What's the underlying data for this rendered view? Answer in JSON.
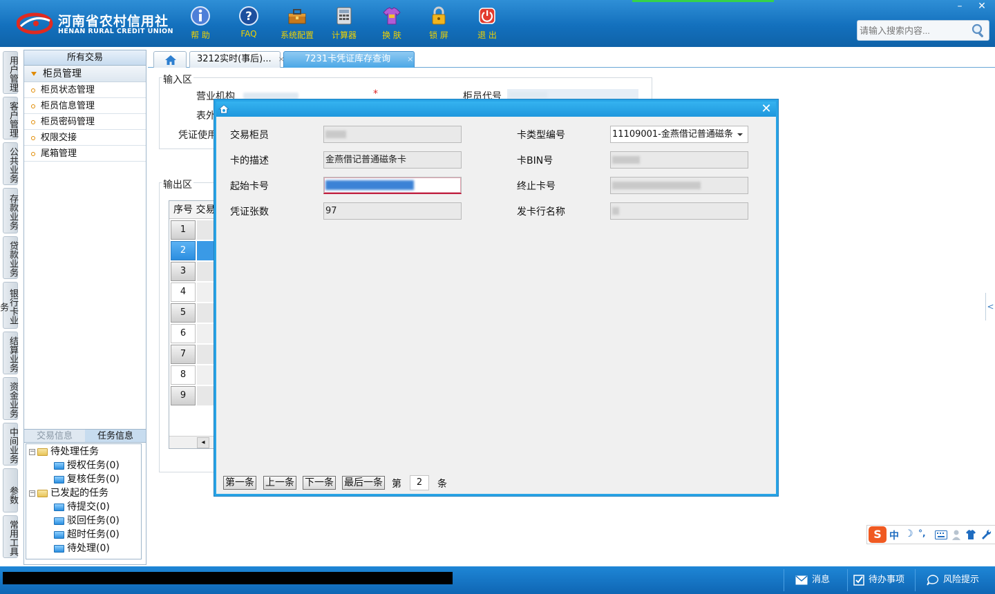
{
  "app": {
    "logo_cn": "河南省农村信用社",
    "logo_en": "HENAN RURAL CREDIT UNION"
  },
  "toolbar": [
    {
      "label": "帮 助",
      "icon": "info-icon"
    },
    {
      "label": "FAQ",
      "icon": "question-icon"
    },
    {
      "label": "系统配置",
      "icon": "toolbox-icon"
    },
    {
      "label": "计算器",
      "icon": "calculator-icon"
    },
    {
      "label": "换 肤",
      "icon": "tshirt-icon"
    },
    {
      "label": "锁 屏",
      "icon": "lock-icon"
    },
    {
      "label": "退 出",
      "icon": "power-icon"
    }
  ],
  "window": {
    "minimize": "–",
    "close": "✕"
  },
  "search": {
    "placeholder": "请输入搜索内容..."
  },
  "vtabs": [
    "用户管理",
    "客户管理",
    "公共业务",
    "存款业务",
    "贷款业务",
    "银行卡业务",
    "结算业务",
    "资金业务",
    "中间业务",
    "参数",
    "常用工具"
  ],
  "leftpanel": {
    "header": "所有交易",
    "group": "柜员管理",
    "items": [
      "柜员状态管理",
      "柜员信息管理",
      "柜员密码管理",
      "权限交接",
      "尾箱管理"
    ],
    "bottom_tabs": [
      "交易信息",
      "任务信息"
    ],
    "tree": {
      "pending": "待处理任务",
      "auth": "授权任务(0)",
      "review": "复核任务(0)",
      "initiated": "已发起的任务",
      "to_submit": "待提交(0)",
      "rejected": "驳回任务(0)",
      "timeout": "超时任务(0)",
      "to_process": "待处理(0)"
    }
  },
  "tabs": [
    {
      "label": "3212实时(事后)...",
      "close": "×"
    },
    {
      "label": "7231卡凭证库存查询",
      "close": "×"
    }
  ],
  "form": {
    "input_zone": "输入区",
    "output_zone": "输出区",
    "branch_label": "营业机构",
    "teller_code_label": "柜员代号",
    "partial_label1": "表外",
    "partial_label2": "凭证使用",
    "required_mark": "*"
  },
  "grid": {
    "header_seq": "序号",
    "header_trade": "交易",
    "rows": [
      "1",
      "2",
      "3",
      "4",
      "5",
      "6",
      "7",
      "8",
      "9"
    ],
    "selected_row": 1,
    "scroll_left": "◂"
  },
  "modal": {
    "close": "✕",
    "fields": {
      "trade_teller_label": "交易柜员",
      "card_type_label": "卡类型编号",
      "card_type_value": "11109001-金燕借记普通磁条",
      "card_desc_label": "卡的描述",
      "card_desc_value": "金燕借记普通磁条卡",
      "card_bin_label": "卡BIN号",
      "start_card_label": "起始卡号",
      "end_card_label": "终止卡号",
      "voucher_count_label": "凭证张数",
      "voucher_count_value": "97",
      "issuer_name_label": "发卡行名称"
    },
    "nav": {
      "first": "第一条",
      "prev": "上一条",
      "next": "下一条",
      "last": "最后一条",
      "page_prefix": "第",
      "page_value": "2",
      "page_suffix": "条"
    }
  },
  "ime": {
    "logo": "S",
    "mode": "中",
    "moon": "☽",
    "punct": "°,"
  },
  "statusbar": {
    "message": "消息",
    "todo": "待办事项",
    "risk": "风险提示"
  },
  "colors": {
    "header_blue": "#1370bd",
    "accent_blue": "#29a4e6",
    "toolbar_label": "#f0d200",
    "focus_red": "#c02040"
  }
}
